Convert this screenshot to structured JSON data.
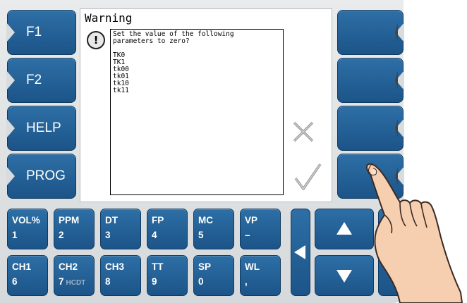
{
  "left_keys": [
    "F1",
    "F2",
    "HELP",
    "PROG"
  ],
  "dialog": {
    "title": "Warning",
    "icon": "exclamation-icon",
    "message": "Set the value of the following\nparameters to zero?",
    "parameters": [
      "TK0",
      "TK1",
      "tk00",
      "tk01",
      "tk10",
      "tk11"
    ],
    "cancel_icon": "x-icon",
    "confirm_icon": "checkmark-icon"
  },
  "keypad": {
    "row1": [
      {
        "top": "VOL%",
        "bottom": "1"
      },
      {
        "top": "PPM",
        "bottom": "2"
      },
      {
        "top": "DT",
        "bottom": "3"
      },
      {
        "top": "FP",
        "bottom": "4"
      },
      {
        "top": "MC",
        "bottom": "5"
      },
      {
        "top": "VP",
        "bottom": "–"
      }
    ],
    "row2": [
      {
        "top": "CH1",
        "bottom": "6"
      },
      {
        "top": "CH2",
        "bottom": "7",
        "extra": "HCDT"
      },
      {
        "top": "CH3",
        "bottom": "8"
      },
      {
        "top": "TT",
        "bottom": "9"
      },
      {
        "top": "SP",
        "bottom": "0"
      },
      {
        "top": "WL",
        "bottom": ","
      }
    ]
  },
  "colors": {
    "key_blue": "#1f5a8f",
    "panel": "#dfe2e4"
  }
}
